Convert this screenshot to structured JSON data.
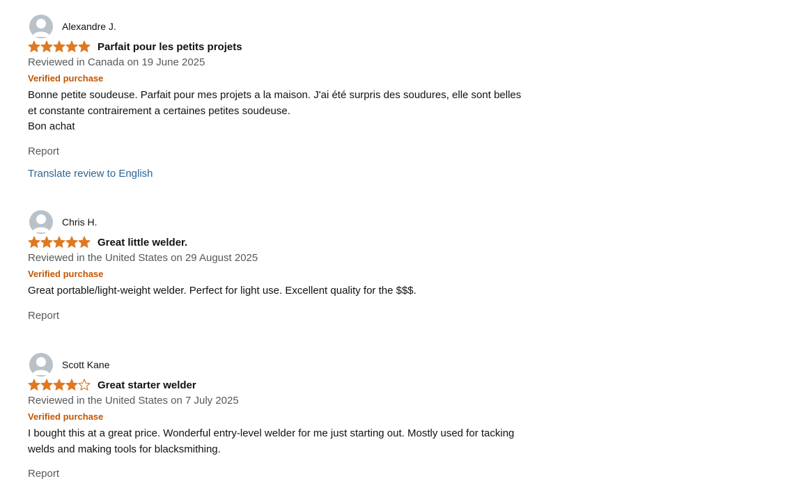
{
  "reviews": [
    {
      "name": "Alexandre J.",
      "rating": 5,
      "title": "Parfait pour les petits projets",
      "date": "Reviewed in Canada on 19 June 2025",
      "verified": "Verified purchase",
      "body": [
        "Bonne petite soudeuse. Parfait pour mes projets a la maison. J'ai été surpris des soudures, elle sont belles",
        "et constante contrairement a certaines petites soudeuse.",
        "Bon achat"
      ],
      "report": "Report",
      "translate": "Translate review to English"
    },
    {
      "name": "Chris H.",
      "rating": 5,
      "title": "Great little welder.",
      "date": "Reviewed in the United States on 29 August 2025",
      "verified": "Verified purchase",
      "body": [
        "Great portable/light-weight welder. Perfect for light use. Excellent quality for the $$$."
      ],
      "report": "Report"
    },
    {
      "name": "Scott Kane",
      "rating": 4,
      "title": "Great starter welder",
      "date": "Reviewed in the United States on 7 July 2025",
      "verified": "Verified purchase",
      "body": [
        "I bought this at a great price. Wonderful entry-level welder for me just starting out. Mostly used for tacking",
        "welds and making tools for blacksmithing."
      ],
      "report": "Report"
    }
  ],
  "icons": {
    "avatar": "user-silhouette-icon",
    "star_filled": "star-filled-icon",
    "star_empty": "star-empty-icon"
  },
  "colors": {
    "star": "#de7921",
    "verified": "#c45500",
    "link": "#2a6496",
    "muted": "#565959",
    "avatar_bg": "#b9c2c9"
  }
}
